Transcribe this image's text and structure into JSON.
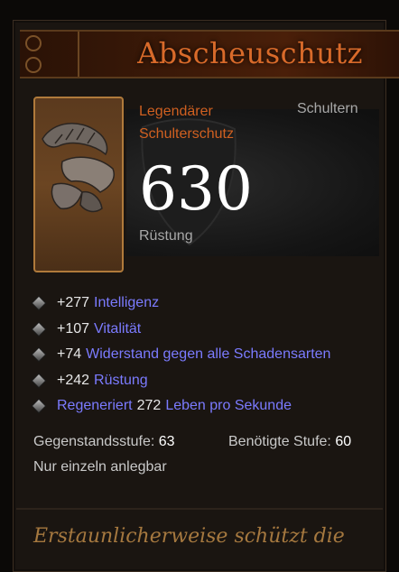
{
  "item": {
    "name": "Abscheuschutz",
    "type_line1": "Legendärer",
    "type_line2": "Schulterschutz",
    "slot": "Schultern",
    "armor_value": "630",
    "armor_label": "Rüstung"
  },
  "stats": [
    {
      "value": "+277",
      "label": "Intelligenz"
    },
    {
      "value": "+107",
      "label": "Vitalität"
    },
    {
      "value": "+74",
      "label": "Widerstand gegen alle Schadensarten"
    },
    {
      "value": "+242",
      "label": "Rüstung"
    },
    {
      "prefix": "Regeneriert",
      "value": "272",
      "label": "Leben pro Sekunde"
    }
  ],
  "meta": {
    "item_level_label": "Gegenstandsstufe:",
    "item_level_value": "63",
    "required_level_label": "Benötigte Stufe:",
    "required_level_value": "60",
    "unique_equip": "Nur einzeln anlegbar"
  },
  "flavor_text": "Erstaunlicherweise schützt die",
  "colors": {
    "legendary": "#d86a2a",
    "affix_blue": "#7b7bff",
    "stat_white": "#e6e6e6",
    "flavor": "#a5783f"
  },
  "icons": {
    "item_icon": "shoulder-armor-icon",
    "bullet": "gem-bullet-icon"
  }
}
